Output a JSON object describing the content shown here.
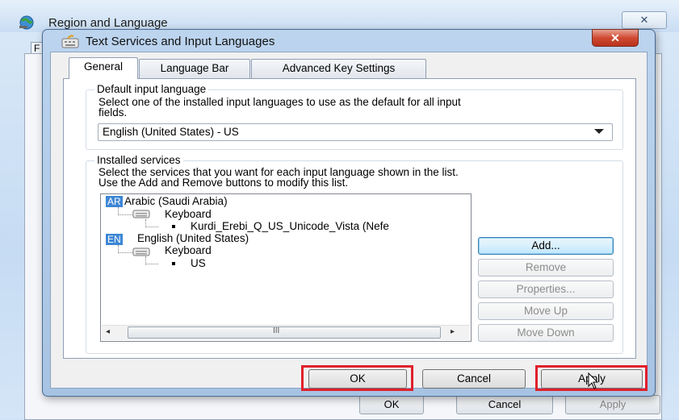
{
  "background_window": {
    "title": "Region and Language",
    "close_glyph": "✕",
    "tab_fragment": "F",
    "buttons": {
      "ok": "OK",
      "cancel": "Cancel",
      "apply": "Apply"
    }
  },
  "dialog": {
    "title": "Text Services and Input Languages",
    "close_glyph": "✕",
    "tabs": [
      {
        "label": "General",
        "selected": true
      },
      {
        "label": "Language Bar",
        "selected": false
      },
      {
        "label": "Advanced Key Settings",
        "selected": false
      }
    ],
    "default_input": {
      "group_label": "Default input language",
      "description_line1": "Select one of the installed input languages to use as the default for all input",
      "description_line2": "fields.",
      "selected_value": "English (United States) - US"
    },
    "installed_services": {
      "group_label": "Installed services",
      "description_line1": "Select the services that you want for each input language shown in the list.",
      "description_line2": "Use the Add and Remove buttons to modify this list.",
      "tree": [
        {
          "code": "AR",
          "language": "Arabic (Saudi Arabia)",
          "category": "Keyboard",
          "layout": "Kurdi_Erebi_Q_US_Unicode_Vista (Nefe"
        },
        {
          "code": "EN",
          "language": "English (United States)",
          "category": "Keyboard",
          "layout": "US"
        }
      ],
      "scrollbar": {
        "left_arrow": "◂",
        "right_arrow": "▸",
        "grip": "III"
      },
      "side_buttons": {
        "add": "Add...",
        "remove": "Remove",
        "properties": "Properties...",
        "move_up": "Move Up",
        "move_down": "Move Down"
      }
    },
    "buttons": {
      "ok": "OK",
      "cancel": "Cancel",
      "apply": "Apply"
    },
    "highlighted_buttons": [
      "ok",
      "apply"
    ],
    "colors": {
      "highlight": "#e0202c",
      "lang_code_bg": "#3d86d6",
      "close_red": "#cf4a31"
    }
  }
}
